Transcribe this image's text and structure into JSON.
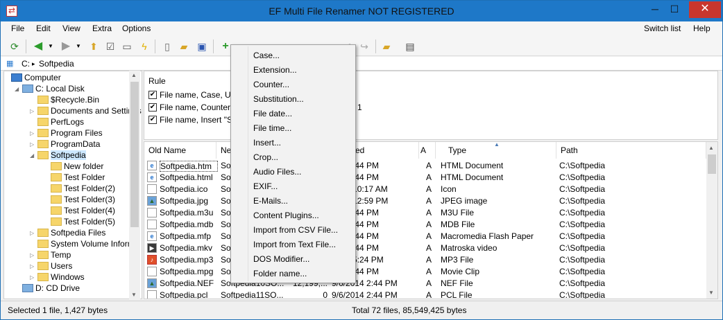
{
  "window": {
    "title": "EF Multi File Renamer NOT REGISTERED",
    "min": "─",
    "max": "☐",
    "close": "✕"
  },
  "menubar": {
    "items": [
      "File",
      "Edit",
      "View",
      "Extra",
      "Options"
    ],
    "right": [
      "Switch list",
      "Help"
    ]
  },
  "toolbar": {
    "icons": [
      "refresh-icon",
      "back-icon",
      "dropdown-icon",
      "forward-icon",
      "dropdown-icon",
      "folder-up-icon",
      "checklist-icon",
      "book-icon",
      "lightning-icon",
      "new-file-icon",
      "open-folder-icon",
      "save-icon",
      "add-icon",
      "edit-icon",
      "delete-icon",
      "move-up-icon",
      "move-down-icon",
      "undo-icon",
      "ok-icon",
      "redo-icon",
      "folder-icon",
      "export-icon"
    ]
  },
  "path": {
    "drive": "C:",
    "separator": "▸",
    "folder": "Softpedia"
  },
  "tree": {
    "items": [
      {
        "label": "Computer",
        "level": 0,
        "kind": "computer"
      },
      {
        "label": "C: Local Disk",
        "level": 1,
        "kind": "drive",
        "expanded": true
      },
      {
        "label": "$Recycle.Bin",
        "level": 2,
        "kind": "folder"
      },
      {
        "label": "Documents and Settings",
        "level": 2,
        "kind": "folder",
        "arrow": true
      },
      {
        "label": "PerfLogs",
        "level": 2,
        "kind": "folder"
      },
      {
        "label": "Program Files",
        "level": 2,
        "kind": "folder",
        "arrow": true
      },
      {
        "label": "ProgramData",
        "level": 2,
        "kind": "folder",
        "arrow": true
      },
      {
        "label": "Softpedia",
        "level": 2,
        "kind": "folder",
        "expanded": true,
        "selected": true
      },
      {
        "label": "New folder",
        "level": 3,
        "kind": "folder"
      },
      {
        "label": "Test Folder",
        "level": 3,
        "kind": "folder"
      },
      {
        "label": "Test Folder(2)",
        "level": 3,
        "kind": "folder"
      },
      {
        "label": "Test Folder(3)",
        "level": 3,
        "kind": "folder"
      },
      {
        "label": "Test Folder(4)",
        "level": 3,
        "kind": "folder"
      },
      {
        "label": "Test Folder(5)",
        "level": 3,
        "kind": "folder"
      },
      {
        "label": "Softpedia Files",
        "level": 2,
        "kind": "folder",
        "arrow": true
      },
      {
        "label": "System Volume Informa",
        "level": 2,
        "kind": "folder"
      },
      {
        "label": "Temp",
        "level": 2,
        "kind": "folder",
        "arrow": true
      },
      {
        "label": "Users",
        "level": 2,
        "kind": "folder",
        "arrow": true
      },
      {
        "label": "Windows",
        "level": 2,
        "kind": "folder",
        "arrow": true
      },
      {
        "label": "D: CD Drive",
        "level": 1,
        "kind": "drive"
      }
    ]
  },
  "rules": {
    "header": "Rule",
    "items": [
      {
        "text": "File name, Case, UPP",
        "checked": true
      },
      {
        "text": "File name, Counter, a",
        "checked": true,
        "tail": "1"
      },
      {
        "text": "File name, Insert \"Sof",
        "checked": true
      }
    ],
    "check": "✔"
  },
  "files": {
    "columns": {
      "old": "Old Name",
      "new": "Ne",
      "date": "ed",
      "attr": "A",
      "type": "Type",
      "path": "Path",
      "sort": "▲"
    },
    "rows": [
      {
        "old": "Softpedia.htm",
        "new": "So",
        "size": "",
        "date": "014  2:44 PM",
        "attr": "A",
        "type": "HTML Document",
        "path": "C:\\Softpedia",
        "icon": "e",
        "selected": true
      },
      {
        "old": "Softpedia.html",
        "new": "So",
        "size": "",
        "date": "014  2:44 PM",
        "attr": "A",
        "type": "HTML Document",
        "path": "C:\\Softpedia",
        "icon": "e"
      },
      {
        "old": "Softpedia.ico",
        "new": "So",
        "size": "",
        "date": "2014  10:17 AM",
        "attr": "A",
        "type": "Icon",
        "path": "C:\\Softpedia",
        "icon": ""
      },
      {
        "old": "Softpedia.jpg",
        "new": "So",
        "size": "",
        "date": "2014  12:59 PM",
        "attr": "A",
        "type": "JPEG image",
        "path": "C:\\Softpedia",
        "icon": "▲"
      },
      {
        "old": "Softpedia.m3u",
        "new": "So",
        "size": "",
        "date": "014  2:44 PM",
        "attr": "A",
        "type": "M3U File",
        "path": "C:\\Softpedia",
        "icon": ""
      },
      {
        "old": "Softpedia.mdb",
        "new": "So",
        "size": "",
        "date": "014  2:44 PM",
        "attr": "A",
        "type": "MDB File",
        "path": "C:\\Softpedia",
        "icon": ""
      },
      {
        "old": "Softpedia.mfp",
        "new": "So",
        "size": "",
        "date": "014  2:44 PM",
        "attr": "A",
        "type": "Macromedia Flash Paper",
        "path": "C:\\Softpedia",
        "icon": "e"
      },
      {
        "old": "Softpedia.mkv",
        "new": "So",
        "size": "",
        "date": "014  2:44 PM",
        "attr": "A",
        "type": "Matroska video",
        "path": "C:\\Softpedia",
        "icon": "▶"
      },
      {
        "old": "Softpedia.mp3",
        "new": "So",
        "size": "",
        "date": "2015  5:24 PM",
        "attr": "A",
        "type": "MP3 File",
        "path": "C:\\Softpedia",
        "icon": "♪"
      },
      {
        "old": "Softpedia.mpg",
        "new": "So",
        "size": "",
        "date": "014  2:44 PM",
        "attr": "A",
        "type": "Movie Clip",
        "path": "C:\\Softpedia",
        "icon": ""
      },
      {
        "old": "Softpedia.NEF",
        "new": "Softpedia10SO...",
        "size": "12,199,...",
        "date": "9/6/2014  2:44 PM",
        "attr": "A",
        "type": "NEF File",
        "path": "C:\\Softpedia",
        "icon": "▲"
      },
      {
        "old": "Softpedia.pcl",
        "new": "Softpedia11SO...",
        "size": "0",
        "date": "9/6/2014  2:44 PM",
        "attr": "A",
        "type": "PCL File",
        "path": "C:\\Softpedia",
        "icon": ""
      }
    ]
  },
  "status": {
    "left": "Selected 1 file, 1,427 bytes",
    "right": "Total 72 files, 85,549,425 bytes"
  },
  "popup": {
    "items": [
      "Case...",
      "Extension...",
      "Counter...",
      "Substitution...",
      "File date...",
      "File time...",
      "Insert...",
      "Crop...",
      "Audio Files...",
      "EXIF...",
      "E-Mails...",
      "Content Plugins...",
      "Import from CSV File...",
      "Import from Text File...",
      "DOS Modifier...",
      "Folder name..."
    ]
  }
}
